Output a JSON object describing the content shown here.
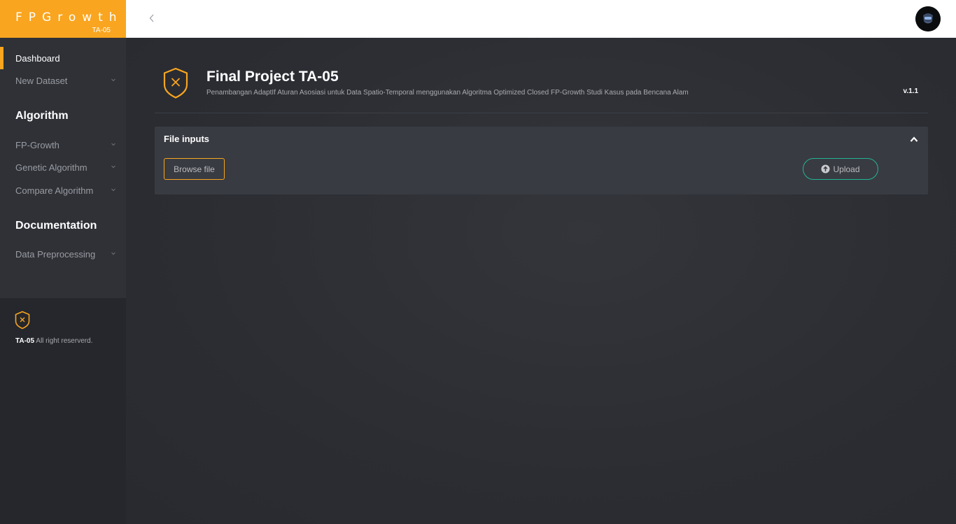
{
  "brand": {
    "title": "FPGrowth",
    "subtitle": "TA-05",
    "color": "#f9a51f"
  },
  "topbar": {
    "collapse_icon": "chevron-left-icon",
    "avatar_icon": "user-avatar-icon"
  },
  "sidebar": {
    "items_top": [
      {
        "label": "Dashboard",
        "active": true
      },
      {
        "label": "New Dataset",
        "caret": true
      }
    ],
    "section_algorithm": "Algorithm",
    "items_algorithm": [
      {
        "label": "FP-Growth"
      },
      {
        "label": "Genetic Algorithm"
      },
      {
        "label": "Compare Algorithm"
      }
    ],
    "section_docs": "Documentation",
    "items_docs": [
      {
        "label": "Data Preprocessing"
      }
    ],
    "footer": {
      "brand": "TA-05",
      "text": "All right reserverd."
    }
  },
  "header": {
    "title": "Final Project TA-05",
    "subtitle": "Penambangan AdaptIf Aturan Asosiasi untuk Data Spatio-Temporal menggunakan Algoritma Optimized Closed FP-Growth Studi Kasus pada Bencana Alam",
    "version": "v.1.1"
  },
  "file_inputs": {
    "title": "File inputs",
    "browse_label": "Browse file",
    "upload_label": "Upload",
    "upload_color": "#1fb694"
  }
}
